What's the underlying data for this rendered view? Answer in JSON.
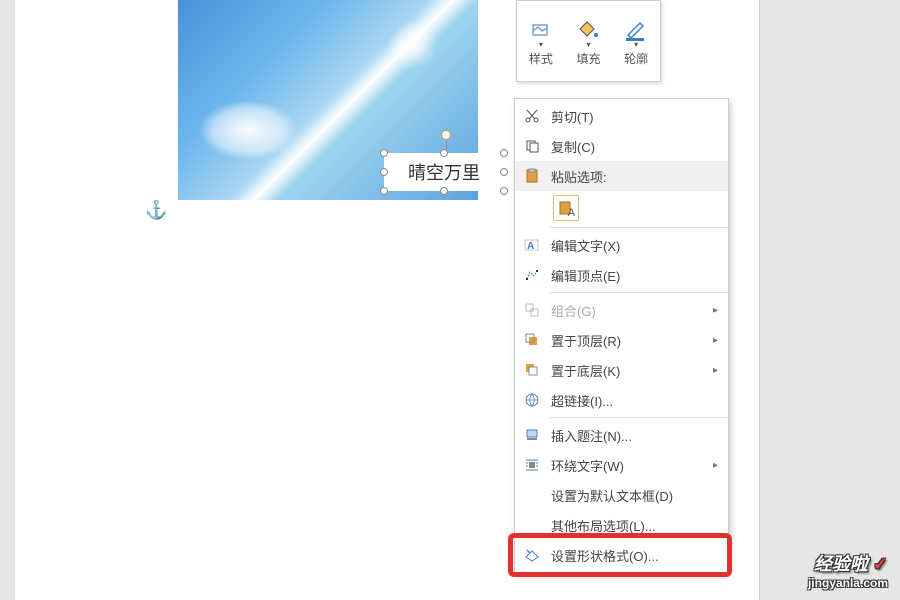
{
  "textbox": {
    "text": "晴空万里"
  },
  "mini_toolbar": {
    "style": "样式",
    "fill": "填充",
    "outline": "轮廓"
  },
  "context_menu": {
    "cut": "剪切(T)",
    "copy": "复制(C)",
    "paste_header": "粘贴选项:",
    "paste_text_only": "A",
    "edit_text": "编辑文字(X)",
    "edit_points": "编辑顶点(E)",
    "group": "组合(G)",
    "bring_front": "置于顶层(R)",
    "send_back": "置于底层(K)",
    "hyperlink": "超链接(I)...",
    "insert_caption": "插入题注(N)...",
    "wrap_text": "环绕文字(W)",
    "set_default": "设置为默认文本框(D)",
    "more_layout": "其他布局选项(L)...",
    "format_shape": "设置形状格式(O)..."
  },
  "watermark": {
    "line1": "经验啦",
    "line2": "jingyanla.com"
  }
}
